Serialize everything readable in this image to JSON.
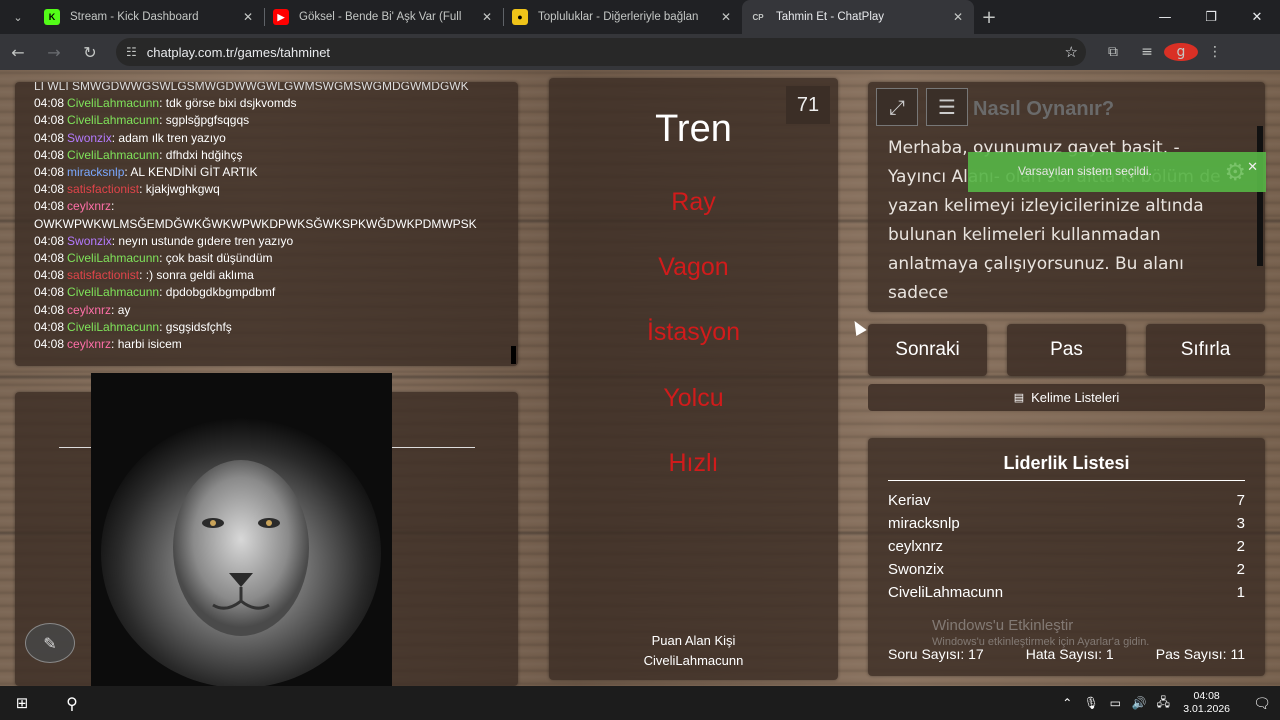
{
  "browser": {
    "tabs": [
      {
        "title": "Stream - Kick Dashboard",
        "icon": "kick-icon",
        "color": "#53fc18"
      },
      {
        "title": "Göksel - Bende Bi' Aşk Var (Full",
        "icon": "youtube-icon",
        "color": "#ff0000"
      },
      {
        "title": "Topluluklar - Diğerleriyle bağlan",
        "icon": "community-icon",
        "color": "#f0c419"
      },
      {
        "title": "Tahmin Et - ChatPlay",
        "icon": "chatplay-icon",
        "color": "#3b82f6",
        "active": true
      }
    ],
    "url": "chatplay.com.tr/games/tahminet",
    "profile_initial": "g"
  },
  "chat": {
    "cut_line": "LI WLI SMWGDWWGSWLGSMWGDWWGWLGWMSWGMSWGMDGWMDGWK",
    "messages": [
      {
        "time": "04:08",
        "user": "CiveliLahmacunn",
        "color": "#7fe35a",
        "text": "tdk görse bixi dsjkvomds"
      },
      {
        "time": "04:08",
        "user": "CiveliLahmacunn",
        "color": "#7fe35a",
        "text": "sgplsğpgfsqgqs"
      },
      {
        "time": "04:08",
        "user": "Swonzix",
        "color": "#b57bff",
        "text": "adam ılk tren yazıyo"
      },
      {
        "time": "04:08",
        "user": "CiveliLahmacunn",
        "color": "#7fe35a",
        "text": "dfhdxi hdğihçş"
      },
      {
        "time": "04:08",
        "user": "miracksnlp",
        "color": "#7aa8ff",
        "text": "AL KENDİNİ GİT ARTIK"
      },
      {
        "time": "04:08",
        "user": "satisfactionist",
        "color": "#e0444a",
        "text": "kjakjwghkgwq"
      },
      {
        "time": "04:08",
        "user": "ceylxnrz",
        "color": "#ff6fa8",
        "text": "",
        "wrap": "OWKWPWKWLMSĞEMDĞWKĞWKWPWKDPWKSĞWKSPKWĞDWKPDMWPSK"
      },
      {
        "time": "04:08",
        "user": "Swonzix",
        "color": "#b57bff",
        "text": "neyın ustunde gıdere tren yazıyo"
      },
      {
        "time": "04:08",
        "user": "CiveliLahmacunn",
        "color": "#7fe35a",
        "text": "çok basit düşündüm"
      },
      {
        "time": "04:08",
        "user": "satisfactionist",
        "color": "#e0444a",
        "text": ":) sonra geldi aklıma"
      },
      {
        "time": "04:08",
        "user": "CiveliLahmacunn",
        "color": "#7fe35a",
        "text": "dpdobgdkbgmpdbmf"
      },
      {
        "time": "04:08",
        "user": "ceylxnrz",
        "color": "#ff6fa8",
        "text": "ay"
      },
      {
        "time": "04:08",
        "user": "CiveliLahmacunn",
        "color": "#7fe35a",
        "text": "gsgşidsfçhfş"
      },
      {
        "time": "04:08",
        "user": "ceylxnrz",
        "color": "#ff6fa8",
        "text": "harbi isicem"
      }
    ]
  },
  "game": {
    "timer": "71",
    "target_word": "Tren",
    "taboo_words": [
      "Ray",
      "Vagon",
      "İstasyon",
      "Yolcu",
      "Hızlı"
    ],
    "scorer_label": "Puan Alan Kişi",
    "scorer_name": "CiveliLahmacunn"
  },
  "info": {
    "title": "Nasıl Oynanır?",
    "text": "Merhaba, oyunumuz gayet basit. -Yayıncı Alanı- olan sol altta ki bölüm de yazan kelimeyi izleyicilerinize altında bulunan kelimeleri kullanmadan anlatmaya çalışıyorsunuz. Bu alanı sadece"
  },
  "toast": {
    "message": "Varsayılan sistem seçildi."
  },
  "buttons": {
    "next": "Sonraki",
    "pass": "Pas",
    "reset": "Sıfırla",
    "word_lists": "Kelime Listeleri"
  },
  "leaderboard": {
    "title": "Liderlik Listesi",
    "rows": [
      {
        "name": "Keriav",
        "score": "7"
      },
      {
        "name": "miracksnlp",
        "score": "3"
      },
      {
        "name": "ceylxnrz",
        "score": "2"
      },
      {
        "name": "Swonzix",
        "score": "2"
      },
      {
        "name": "CiveliLahmacunn",
        "score": "1"
      }
    ],
    "questions": "Soru Sayısı: 17",
    "errors": "Hata Sayısı: 1",
    "passes": "Pas Sayısı: 11"
  },
  "windows": {
    "watermark_title": "Windows'u Etkinleştir",
    "watermark_sub": "Windows'u etkinleştirmek için Ayarlar'a gidin.",
    "time": "04:08",
    "date": "3.01.2026"
  }
}
